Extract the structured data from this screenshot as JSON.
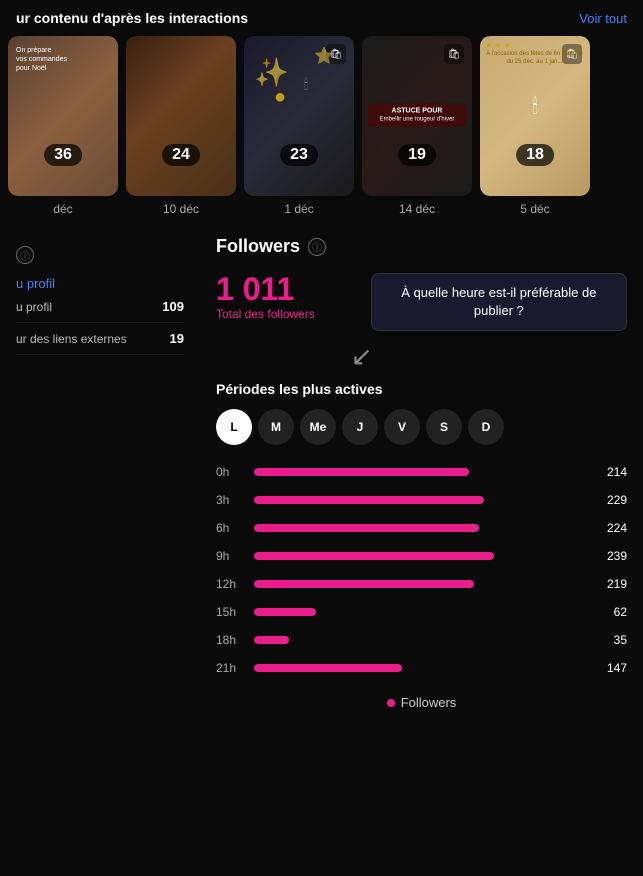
{
  "header": {
    "title": "ur contenu d'après les interactions",
    "voir_tout": "Voir tout"
  },
  "cards": [
    {
      "id": 1,
      "style": "brown",
      "badge": "36",
      "date": "déc",
      "text_lines": [
        "On prépare",
        "vos commandes",
        "pour Noël"
      ]
    },
    {
      "id": 2,
      "style": "dark-brown",
      "badge": "24",
      "date": "10 déc"
    },
    {
      "id": 3,
      "style": "dark-lights",
      "badge": "23",
      "date": "1 déc",
      "has_icon": true
    },
    {
      "id": 4,
      "style": "dark-gifts",
      "badge": "19",
      "date": "14 déc",
      "astuce": "ASTUCE POUR",
      "astuce_sub": "Embellir une rougeur d'hiver",
      "has_icon": true
    },
    {
      "id": 5,
      "style": "gold",
      "badge": "18",
      "date": "5 déc",
      "has_icon": true
    }
  ],
  "left_panel": {
    "info_label": "ⓘ",
    "profile_link": "u profil",
    "stats": [
      {
        "label": "u profil",
        "value": "109"
      },
      {
        "label": "ur des liens externes",
        "value": "19"
      }
    ]
  },
  "followers": {
    "title": "Followers",
    "info_icon": "ⓘ",
    "tooltip": "À quelle heure est-il préférable de publier ?",
    "total": "1 011",
    "total_label": "Total des followers",
    "periodes_title": "Périodes les plus actives",
    "days": [
      {
        "label": "L",
        "active": true
      },
      {
        "label": "M",
        "active": false
      },
      {
        "label": "Me",
        "active": false
      },
      {
        "label": "J",
        "active": false
      },
      {
        "label": "V",
        "active": false
      },
      {
        "label": "S",
        "active": false
      },
      {
        "label": "D",
        "active": false
      }
    ],
    "bars": [
      {
        "time": "0h",
        "value": 214,
        "max": 239
      },
      {
        "time": "3h",
        "value": 229,
        "max": 239
      },
      {
        "time": "6h",
        "value": 224,
        "max": 239
      },
      {
        "time": "9h",
        "value": 239,
        "max": 239
      },
      {
        "time": "12h",
        "value": 219,
        "max": 239
      },
      {
        "time": "15h",
        "value": 62,
        "max": 239
      },
      {
        "time": "18h",
        "value": 35,
        "max": 239
      },
      {
        "time": "21h",
        "value": 147,
        "max": 239
      }
    ],
    "legend_label": "Followers"
  }
}
